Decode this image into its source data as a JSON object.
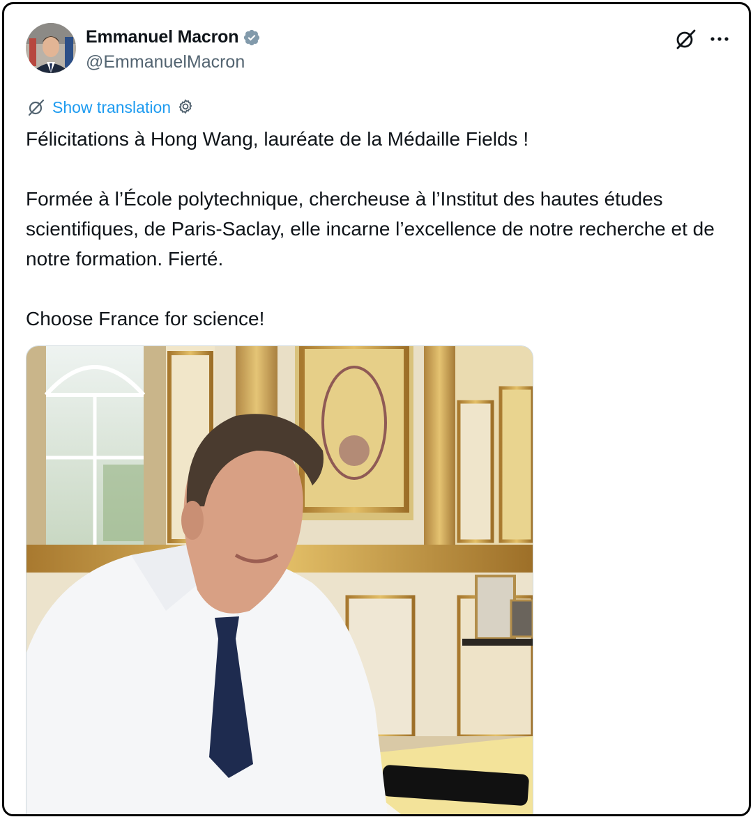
{
  "author": {
    "display_name": "Emmanuel Macron",
    "handle": "@EmmanuelMacron",
    "verified_icon": "verified-badge-icon",
    "avatar_icon": "profile-photo"
  },
  "actions": {
    "grok_icon": "grok-icon",
    "more_icon": "more-icon"
  },
  "translation": {
    "link_label": "Show translation",
    "translate_icon": "grok-icon",
    "settings_icon": "gear-icon"
  },
  "tweet": {
    "text": "Félicitations à Hong Wang, lauréate de la Médaille Fields !\n\nFormée à l’École polytechnique, chercheuse à l’Institut des hautes études scientifiques, de Paris-Saclay, elle incarne l’excellence de notre recherche et de notre formation. Fierté.\n\nChoose France for science!"
  },
  "media": {
    "type": "photo"
  },
  "colors": {
    "accent": "#1d9bf0",
    "secondary_text": "#536471",
    "primary_text": "#0f1419"
  }
}
